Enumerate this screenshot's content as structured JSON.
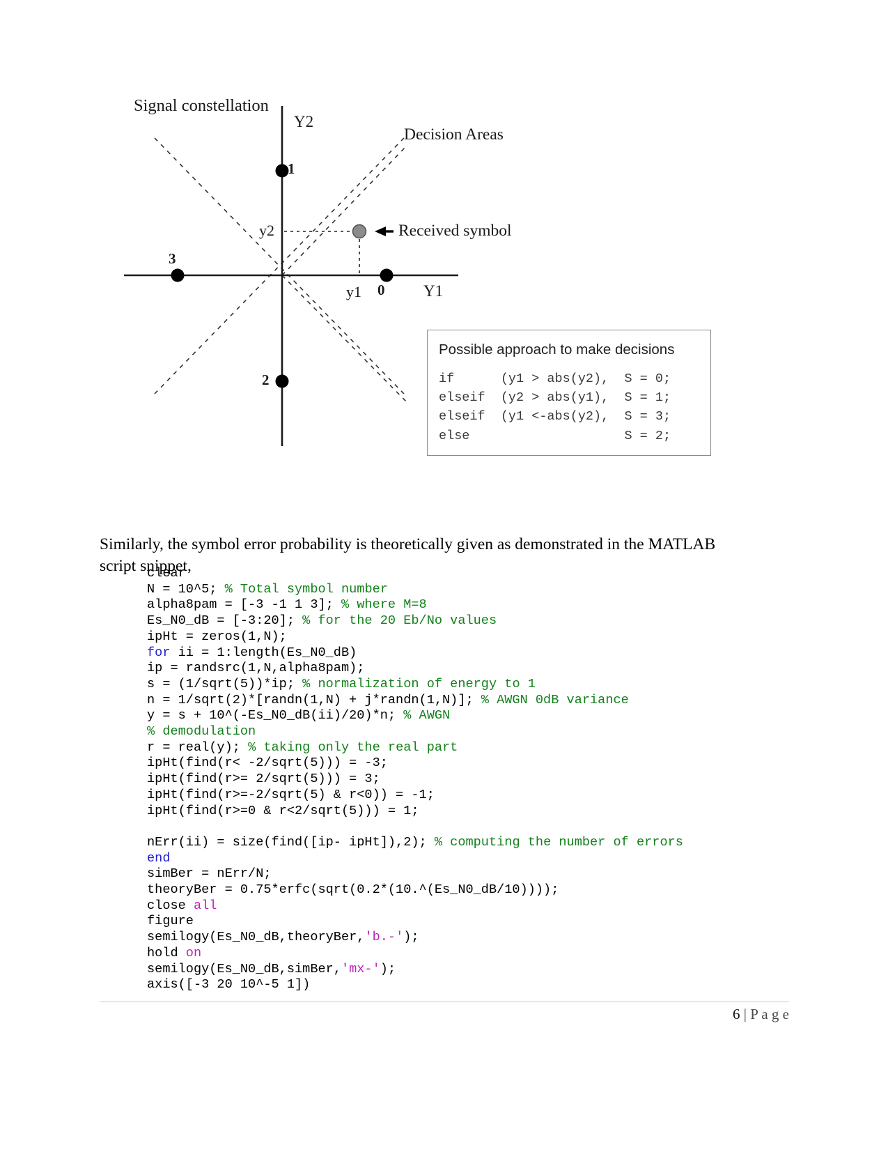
{
  "figure": {
    "title_label": "Signal constellation",
    "decision_areas_label": "Decision Areas",
    "received_symbol_label": "Received symbol",
    "axis_y2_label": "Y2",
    "axis_y1_label": "Y1",
    "origin_label": "0",
    "coord_y2_label": "y2",
    "coord_y1_label": "y1",
    "point_labels": {
      "top": "1",
      "bottom": "2",
      "left": "3"
    },
    "colors": {
      "axis": "#1a1a1a",
      "constellation_point": "#000000",
      "received_symbol": "#808080",
      "dashed_boundary": "#333333",
      "box_border": "#8a8a8a"
    }
  },
  "decision_box": {
    "title": "Possible approach to make decisions",
    "lines": [
      "if      (y1 > abs(y2),  S = 0;",
      "elseif  (y2 > abs(y1),  S = 1;",
      "elseif  (y1 <-abs(y2),  S = 3;",
      "else                    S = 2;"
    ]
  },
  "paragraph": {
    "text": "Similarly, the symbol error probability is theoretically given as demonstrated in the MATLAB script snippet,"
  },
  "code": {
    "language": "MATLAB",
    "lines": [
      [
        {
          "t": "clear",
          "c": "plain"
        }
      ],
      [
        {
          "t": "N = 10^5; ",
          "c": "plain"
        },
        {
          "t": "% Total symbol number",
          "c": "comment"
        }
      ],
      [
        {
          "t": "alpha8pam = [-3 -1 1 3]; ",
          "c": "plain"
        },
        {
          "t": "% where M=8",
          "c": "comment"
        }
      ],
      [
        {
          "t": "Es_N0_dB = [-3:20]; ",
          "c": "plain"
        },
        {
          "t": "% for the 20 Eb/No values",
          "c": "comment"
        }
      ],
      [
        {
          "t": "ipHt = zeros(1,N);",
          "c": "plain"
        }
      ],
      [
        {
          "t": "for",
          "c": "keyword"
        },
        {
          "t": " ii = 1:length(Es_N0_dB)",
          "c": "plain"
        }
      ],
      [
        {
          "t": "ip = randsrc(1,N,alpha8pam);",
          "c": "plain"
        }
      ],
      [
        {
          "t": "s = (1/sqrt(5))*ip; ",
          "c": "plain"
        },
        {
          "t": "% normalization of energy to 1",
          "c": "comment"
        }
      ],
      [
        {
          "t": "n = 1/sqrt(2)*[randn(1,N) + j*randn(1,N)]; ",
          "c": "plain"
        },
        {
          "t": "% AWGN 0dB variance",
          "c": "comment"
        }
      ],
      [
        {
          "t": "y = s + 10^(-Es_N0_dB(ii)/20)*n; ",
          "c": "plain"
        },
        {
          "t": "% AWGN",
          "c": "comment"
        }
      ],
      [
        {
          "t": "% demodulation",
          "c": "comment"
        }
      ],
      [
        {
          "t": "r = real(y); ",
          "c": "plain"
        },
        {
          "t": "% taking only the real part",
          "c": "comment"
        }
      ],
      [
        {
          "t": "ipHt(find(r< -2/sqrt(5))) = -3;",
          "c": "plain"
        }
      ],
      [
        {
          "t": "ipHt(find(r>= 2/sqrt(5))) = 3;",
          "c": "plain"
        }
      ],
      [
        {
          "t": "ipHt(find(r>=-2/sqrt(5) & r<0)) = -1;",
          "c": "plain"
        }
      ],
      [
        {
          "t": "ipHt(find(r>=0 & r<2/sqrt(5))) = 1;",
          "c": "plain"
        }
      ],
      [],
      [
        {
          "t": "nErr(ii) = size(find([ip- ipHt]),2); ",
          "c": "plain"
        },
        {
          "t": "% computing the number of errors",
          "c": "comment"
        }
      ],
      [
        {
          "t": "end",
          "c": "keyword"
        }
      ],
      [
        {
          "t": "simBer = nErr/N;",
          "c": "plain"
        }
      ],
      [
        {
          "t": "theoryBer = 0.75*erfc(sqrt(0.2*(10.^(Es_N0_dB/10))));",
          "c": "plain"
        }
      ],
      [
        {
          "t": "close ",
          "c": "plain"
        },
        {
          "t": "all",
          "c": "string"
        }
      ],
      [
        {
          "t": "figure",
          "c": "plain"
        }
      ],
      [
        {
          "t": "semilogy(Es_N0_dB,theoryBer,",
          "c": "plain"
        },
        {
          "t": "'b.-'",
          "c": "string"
        },
        {
          "t": ");",
          "c": "plain"
        }
      ],
      [
        {
          "t": "hold ",
          "c": "plain"
        },
        {
          "t": "on",
          "c": "string"
        }
      ],
      [
        {
          "t": "semilogy(Es_N0_dB,simBer,",
          "c": "plain"
        },
        {
          "t": "'mx-'",
          "c": "string"
        },
        {
          "t": ");",
          "c": "plain"
        }
      ],
      [
        {
          "t": "axis([-3 20 10^-5 1])",
          "c": "plain"
        }
      ]
    ]
  },
  "footer": {
    "page_number": "6",
    "page_separator": " | ",
    "page_word": "P a g e"
  }
}
